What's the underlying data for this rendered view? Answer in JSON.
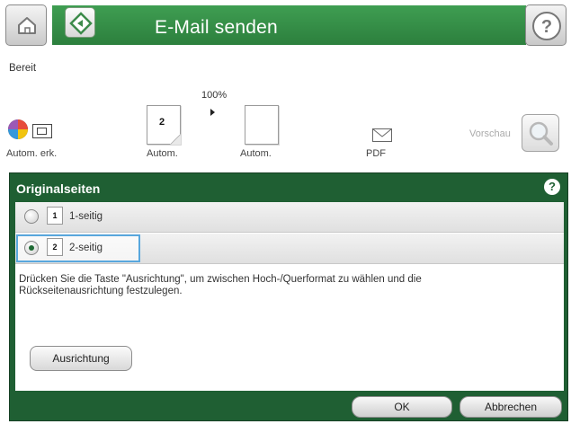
{
  "header": {
    "title": "E-Mail senden",
    "home_icon": "home-icon",
    "start_icon": "start-icon",
    "help_icon": "help-icon"
  },
  "status": {
    "text": "Bereit"
  },
  "scan_settings": {
    "zoom": "100%",
    "color_label": "Autom. erk.",
    "sides_label": "Autom.",
    "sides_page_number": "2",
    "size_label": "Autom.",
    "file_type_label": "PDF",
    "preview_label": "Vorschau"
  },
  "dialog": {
    "title": "Originalseiten",
    "help_symbol": "?",
    "options": [
      {
        "page": "1",
        "label": "1-seitig",
        "selected": false
      },
      {
        "page": "2",
        "label": "2-seitig",
        "selected": true
      }
    ],
    "instruction": "Drücken Sie die Taste \"Ausrichtung\", um zwischen Hoch-/Querformat zu wählen und die Rückseitenausrichtung festzulegen.",
    "orientation_button": "Ausrichtung",
    "ok_button": "OK",
    "cancel_button": "Abbrechen"
  }
}
